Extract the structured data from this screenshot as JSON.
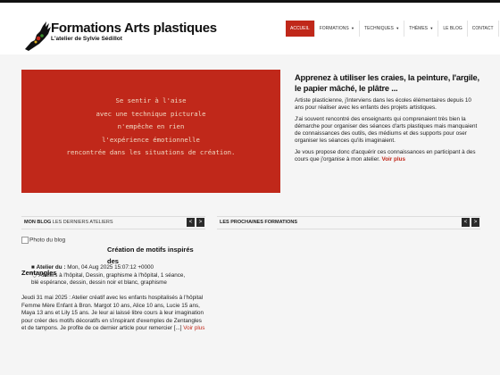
{
  "header": {
    "title": "Formations Arts plastiques",
    "subtitle": "L'atelier de Sylvie Sédillot"
  },
  "nav": {
    "items": [
      {
        "label": "Accueil",
        "active": true
      },
      {
        "label": "Formations",
        "dropdown": true
      },
      {
        "label": "Techniques",
        "dropdown": true
      },
      {
        "label": "Thèmes",
        "dropdown": true
      },
      {
        "label": "Le blog"
      },
      {
        "label": "Contact"
      }
    ]
  },
  "hero": {
    "lines": [
      "Se sentir à l'aise",
      "avec une technique picturale",
      "n'empêche en rien",
      "l'expérience émotionnelle",
      "rencontrée dans les situations de création."
    ]
  },
  "intro": {
    "heading": "Apprenez à utiliser les craies, la peinture, l'argile, le papier mâché, le plâtre ...",
    "p1": "Artiste plasticienne, j'interviens dans les écoles élémentaires depuis 10 ans pour réaliser avec les enfants des projets artistiques.",
    "p2": "J'ai souvent rencontré des enseignants qui comprenaient très bien la démarche pour organiser des séances d'arts plastiques mais manquaient de connaissances des outils, des médiums et des supports pour oser organiser les séances qu'ils imaginaient.",
    "p3": "Je vous propose donc d'acquérir ces connaissances en participant à des cours que j'organise à mon atelier.",
    "more": "Voir plus"
  },
  "blog_panel": {
    "title": "Mon blog",
    "subtitle": "Les derniers ateliers",
    "prev": "<",
    "next": ">"
  },
  "formations_panel": {
    "title": "Les prochaines formations",
    "prev": "<",
    "next": ">"
  },
  "post": {
    "image_alt": "Photo du blog",
    "title_line1": "Création de motifs inspirés des",
    "title_line2": "Zentangles",
    "author_label": "Atelier du :",
    "date": "Mon, 04 Aug 2025 15:07:12 +0000",
    "tags": "Ateliers à l'hôpital, Dessin, graphisme à l'hôpital, 1 séance, blé espérance, dessin, dessin noir et blanc, graphisme",
    "body": "Jeudi 31 mai 2025 : Atelier créatif avec les enfants hospitalisés à l'hôpital Femme Mère Enfant à Bron. Margot 10 ans, Alice 10 ans, Lucie 15 ans, Maya 13 ans et Lily 15 ans. Je leur ai laissé libre cours à leur imagination pour créer des motifs décoratifs en s'inspirant d'exemples de Zentangles et de tampons. Je profite de ce dernier article pour remercier [...]",
    "more": "Voir plus"
  },
  "colors": {
    "accent": "#c0281a",
    "hero_text": "#f0d9c2",
    "dark": "#2b2b2b"
  }
}
